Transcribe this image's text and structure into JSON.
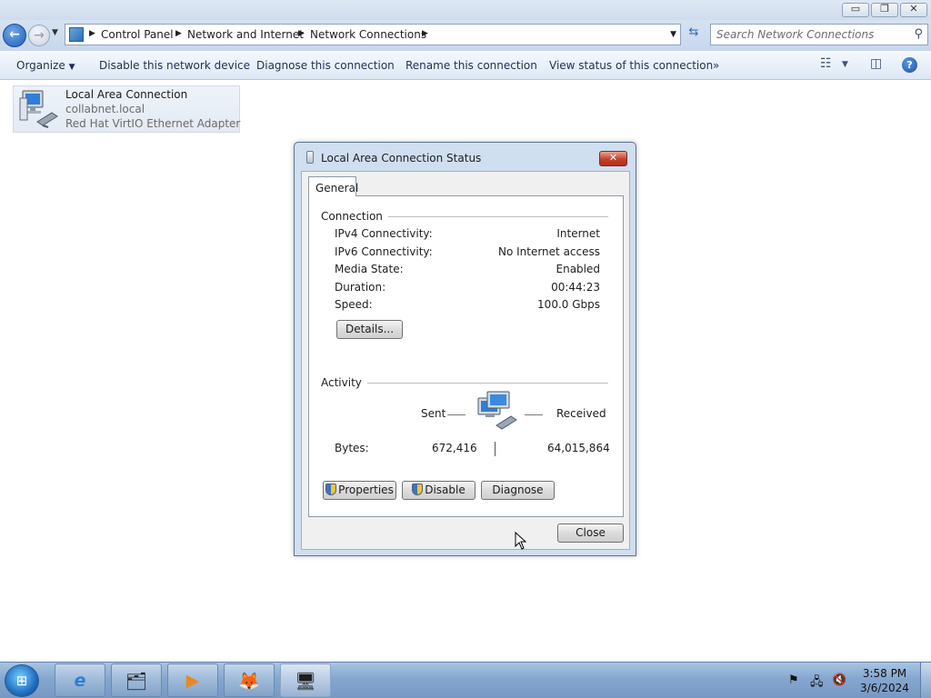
{
  "window": {
    "caption_buttons": {
      "minimize": "▭",
      "maximize": "❐",
      "close": "✕"
    }
  },
  "address_bar": {
    "breadcrumbs": [
      "Control Panel",
      "Network and Internet",
      "Network Connections"
    ],
    "search_placeholder": "Search Network Connections"
  },
  "command_bar": {
    "organize": "Organize",
    "items": [
      "Disable this network device",
      "Diagnose this connection",
      "Rename this connection",
      "View status of this connection"
    ],
    "more": "»"
  },
  "connection_item": {
    "name": "Local Area Connection",
    "network": "collabnet.local",
    "adapter": "Red Hat VirtIO Ethernet Adapter"
  },
  "dialog": {
    "title": "Local Area Connection Status",
    "tab": "General",
    "connection_group": "Connection",
    "rows": [
      {
        "label": "IPv4 Connectivity:",
        "value": "Internet"
      },
      {
        "label": "IPv6 Connectivity:",
        "value": "No Internet access"
      },
      {
        "label": "Media State:",
        "value": "Enabled"
      },
      {
        "label": "Duration:",
        "value": "00:44:23"
      },
      {
        "label": "Speed:",
        "value": "100.0 Gbps"
      }
    ],
    "details_button": "Details...",
    "activity_group": "Activity",
    "sent_label": "Sent",
    "received_label": "Received",
    "bytes_label": "Bytes:",
    "bytes_sent": "672,416",
    "bytes_received": "64,015,864",
    "properties_button": "Properties",
    "disable_button": "Disable",
    "diagnose_button": "Diagnose",
    "close_button": "Close"
  },
  "taskbar": {
    "start_glyph": "⊞",
    "buttons": [
      {
        "name": "internet-explorer",
        "glyph": "e"
      },
      {
        "name": "windows-explorer",
        "glyph": "🗂"
      },
      {
        "name": "media-player",
        "glyph": "▶"
      },
      {
        "name": "firefox",
        "glyph": "🦊"
      },
      {
        "name": "control-panel",
        "glyph": "🖥"
      }
    ],
    "clock_time": "3:58 PM",
    "clock_date": "3/6/2024"
  },
  "colors": {
    "accent": "#1d5fb8",
    "titlebar": "#cfdcec",
    "dialog_close": "#c3402c",
    "taskbar": "#85a7cf"
  }
}
